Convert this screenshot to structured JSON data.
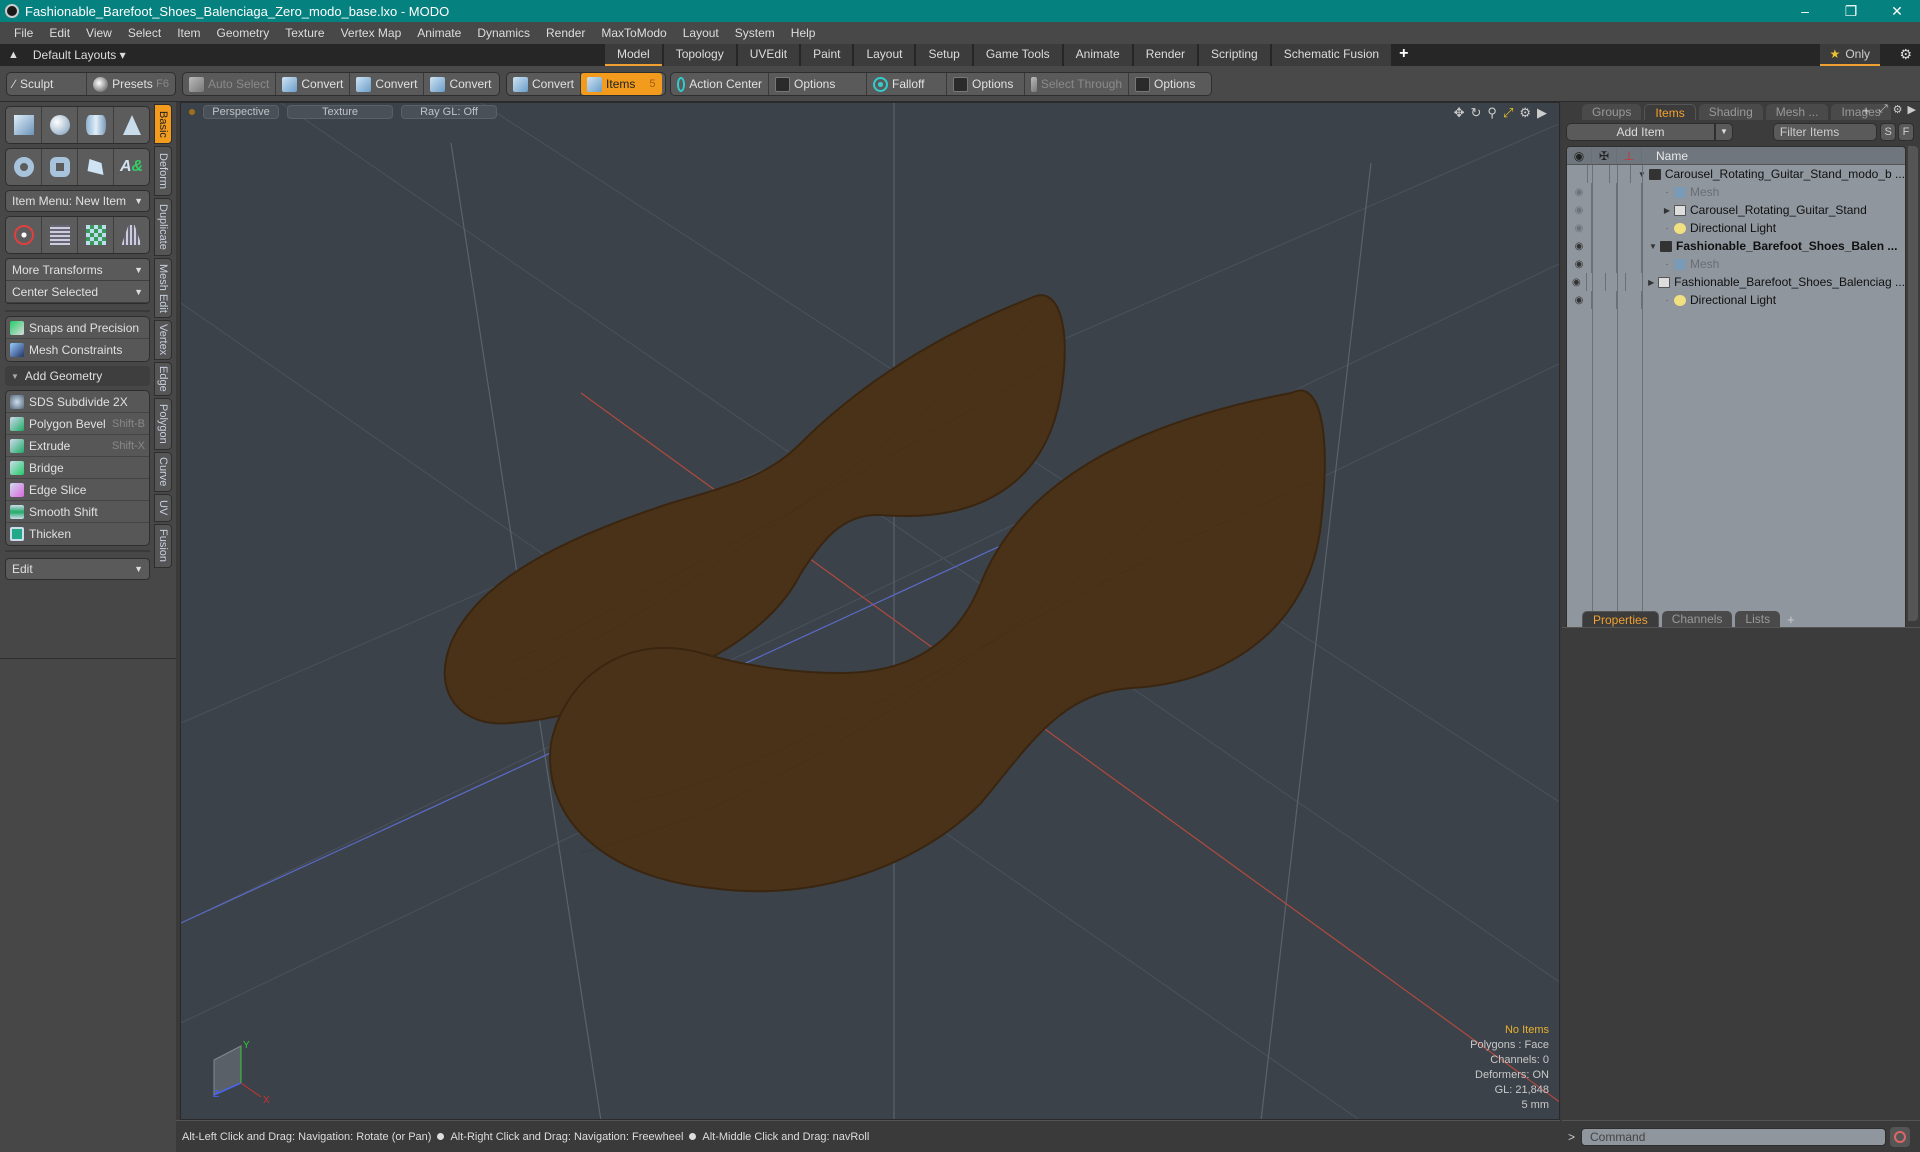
{
  "window": {
    "title": "Fashionable_Barefoot_Shoes_Balenciaga_Zero_modo_base.lxo - MODO",
    "controls": [
      "minimize",
      "restore",
      "close"
    ]
  },
  "menu": [
    "File",
    "Edit",
    "View",
    "Select",
    "Item",
    "Geometry",
    "Texture",
    "Vertex Map",
    "Animate",
    "Dynamics",
    "Render",
    "MaxToModo",
    "Layout",
    "System",
    "Help"
  ],
  "layoutbar": {
    "default_layouts": "Default Layouts ▾",
    "tabs": [
      {
        "label": "Model",
        "active": true
      },
      {
        "label": "Topology"
      },
      {
        "label": "UVEdit"
      },
      {
        "label": "Paint"
      },
      {
        "label": "Layout"
      },
      {
        "label": "Setup"
      },
      {
        "label": "Game Tools"
      },
      {
        "label": "Animate"
      },
      {
        "label": "Render"
      },
      {
        "label": "Scripting"
      },
      {
        "label": "Schematic Fusion"
      }
    ],
    "add_tab": "+",
    "only_label": "Only"
  },
  "toolbar": {
    "sculpt": "Sculpt",
    "presets": "Presets",
    "presets_key": "F6",
    "auto_select": "Auto Select",
    "convert1": "Convert",
    "convert2": "Convert",
    "convert3": "Convert",
    "convert4": "Convert",
    "items": "Items",
    "items_count": "5",
    "action_center": "Action Center",
    "options1": "Options",
    "falloff": "Falloff",
    "options2": "Options",
    "select_through": "Select Through",
    "options3": "Options"
  },
  "leftpanel": {
    "item_menu": "Item Menu: New Item",
    "more_transforms": "More Transforms",
    "center_selected": "Center Selected",
    "snaps": "Snaps and Precision",
    "mesh_constraints": "Mesh Constraints",
    "add_geometry": "Add Geometry",
    "tools": [
      {
        "label": "SDS Subdivide 2X",
        "shortcut": ""
      },
      {
        "label": "Polygon Bevel",
        "shortcut": "Shift-B"
      },
      {
        "label": "Extrude",
        "shortcut": "Shift-X"
      },
      {
        "label": "Bridge",
        "shortcut": ""
      },
      {
        "label": "Edge Slice",
        "shortcut": ""
      },
      {
        "label": "Smooth Shift",
        "shortcut": ""
      },
      {
        "label": "Thicken",
        "shortcut": ""
      }
    ],
    "edit": "Edit",
    "vtabs": [
      "Basic",
      "Deform",
      "Duplicate",
      "Mesh Edit",
      "Vertex",
      "Edge",
      "Polygon",
      "Curve",
      "UV",
      "Fusion"
    ]
  },
  "viewport": {
    "view": "Perspective",
    "shading": "Texture",
    "raygl": "Ray GL: Off",
    "info": {
      "items": "No Items",
      "polygons": "Polygons : Face",
      "channels": "Channels: 0",
      "deformers": "Deformers: ON",
      "gl": "GL: 21,848",
      "units": "5 mm"
    },
    "axis_labels": {
      "y": "Y",
      "x": "X",
      "z": "Z"
    },
    "model_color": "#4a3218"
  },
  "statusbar": {
    "hint1": "Alt-Left Click and Drag: Navigation: Rotate (or Pan)",
    "hint2": "Alt-Right Click and Drag: Navigation: Freewheel",
    "hint3": "Alt-Middle Click and Drag: navRoll"
  },
  "rightpanel": {
    "tabs": [
      {
        "label": "Groups"
      },
      {
        "label": "Items",
        "active": true
      },
      {
        "label": "Shading"
      },
      {
        "label": "Mesh ..."
      },
      {
        "label": "Images"
      }
    ],
    "add_item": "Add Item",
    "filter_placeholder": "Filter Items",
    "s_btn": "S",
    "f_btn": "F",
    "name_col": "Name",
    "tree": [
      {
        "label": "Carousel_Rotating_Guitar_Stand_modo_b ...",
        "type": "scene",
        "level": 0,
        "expanded": true,
        "eye": "none"
      },
      {
        "label": "Mesh",
        "type": "mesh",
        "level": 1,
        "dim": true,
        "eye": "dim"
      },
      {
        "label": "Carousel_Rotating_Guitar_Stand",
        "type": "folder",
        "level": 1,
        "collapsed": true,
        "eye": "dim"
      },
      {
        "label": "Directional Light",
        "type": "light",
        "level": 1,
        "eye": "dim"
      },
      {
        "label": "Fashionable_Barefoot_Shoes_Balen ...",
        "type": "scene",
        "level": 0,
        "expanded": true,
        "bold": true,
        "eye": "on"
      },
      {
        "label": "Mesh",
        "type": "mesh",
        "level": 1,
        "dim": true,
        "eye": "on"
      },
      {
        "label": "Fashionable_Barefoot_Shoes_Balenciag ...",
        "type": "folder",
        "level": 1,
        "collapsed": true,
        "eye": "on"
      },
      {
        "label": "Directional Light",
        "type": "light",
        "level": 1,
        "eye": "on"
      }
    ],
    "bottom_tabs": [
      {
        "label": "Properties",
        "active": true
      },
      {
        "label": "Channels"
      },
      {
        "label": "Lists"
      }
    ],
    "command_placeholder": "Command"
  }
}
